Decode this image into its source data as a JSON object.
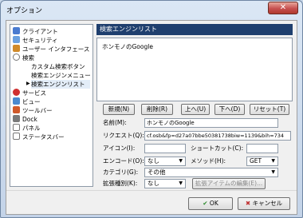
{
  "window": {
    "title": "オプション",
    "close_label": "✕"
  },
  "sidebar": {
    "items": [
      {
        "label": "クライアント",
        "color": "#4a7bd0"
      },
      {
        "label": "セキュリティ",
        "color": "#6aa0e0"
      },
      {
        "label": "ユーザー インタフェース",
        "color": "#d08a2a"
      },
      {
        "label": "検索",
        "color": "#8a8a8a"
      },
      {
        "label": "カスタム検索ボタン",
        "color": ""
      },
      {
        "label": "検索エンジンメニュー",
        "color": ""
      },
      {
        "label": "検索エンジンリスト",
        "color": ""
      },
      {
        "label": "サービス",
        "color": "#d03030"
      },
      {
        "label": "ビュー",
        "color": "#4a8ad0"
      },
      {
        "label": "ツールバー",
        "color": "#d05a2a"
      },
      {
        "label": "Dock",
        "color": "#7a7a7a"
      },
      {
        "label": "パネル",
        "color": "#ffffff"
      },
      {
        "label": "ステータスバー",
        "color": "#ffffff"
      }
    ],
    "selected_index": 6
  },
  "panel": {
    "header": "検索エンジンリスト",
    "list_items": [
      "ホンモノのGoogle"
    ],
    "buttons": {
      "new": "新規(N)",
      "delete": "削除(R)",
      "up": "上へ(U)",
      "down": "下へ(D)",
      "reset": "リセット(T)"
    },
    "form": {
      "name_label": "名前(M):",
      "name_value": "ホンモノのGoogle",
      "request_label": "リクエスト(Q):",
      "request_value": "cf.osb&fp=d27a07bbe50381738biw=1139&bih=734",
      "icon_label": "アイコン(I):",
      "icon_value": "",
      "shortcut_label": "ショートカット(C):",
      "shortcut_value": "",
      "encode_label": "エンコード(O):",
      "encode_value": "なし",
      "method_label": "メソッド(H):",
      "method_value": "GET",
      "category_label": "カテゴリ(G):",
      "category_value": "その他",
      "ext_label": "拡張種別(K):",
      "ext_value": "なし",
      "ext_edit_button": "拡張アイテムの編集(E)..."
    }
  },
  "footer": {
    "ok": "OK",
    "cancel": "キャンセル"
  }
}
